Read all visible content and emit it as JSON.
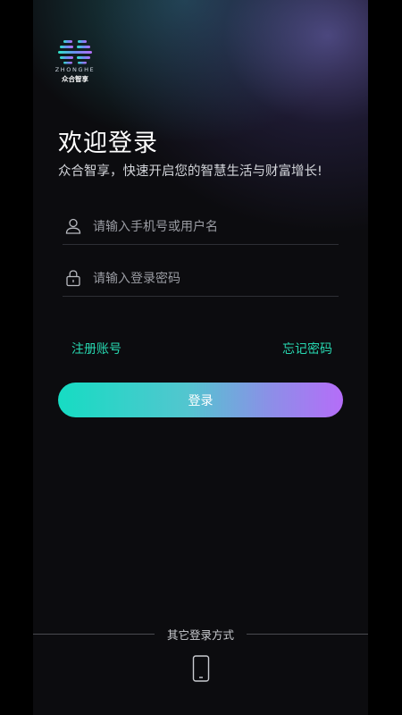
{
  "logo": {
    "en": "ZHONGHE",
    "cn": "众合智享",
    "colors": [
      "#2ee6c8",
      "#6a8cf0",
      "#b56df8"
    ]
  },
  "welcome": {
    "title": "欢迎登录",
    "subtitle": "众合智享，快速开启您的智慧生活与财富增长!"
  },
  "form": {
    "username_placeholder": "请输入手机号或用户名",
    "password_placeholder": "请输入登录密码",
    "register_label": "注册账号",
    "forgot_label": "忘记密码",
    "login_label": "登录"
  },
  "other_login": {
    "label": "其它登录方式",
    "methods": [
      {
        "icon": "phone-icon"
      }
    ]
  },
  "colors": {
    "accent": "#27d7b0",
    "gradient_start": "#16dcc3",
    "gradient_end": "#b56df8",
    "background": "#0c0c0f"
  }
}
